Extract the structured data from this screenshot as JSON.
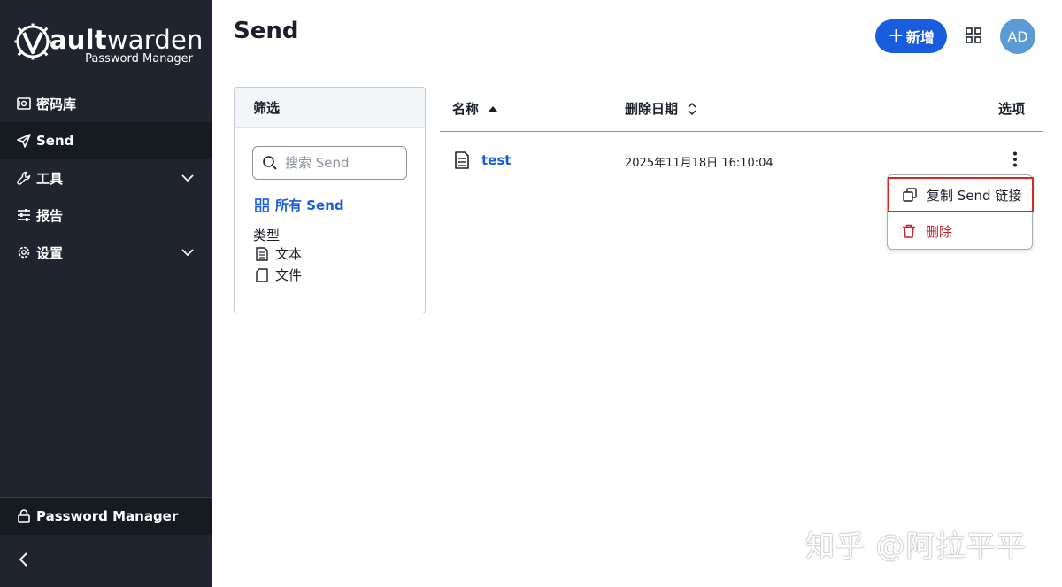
{
  "sidebar": {
    "logo": {
      "word_v": "V",
      "word_bold": "ault",
      "word_rest": "warden",
      "subtitle": "Password Manager"
    },
    "items": [
      {
        "label": "密码库",
        "icon": "vault-icon"
      },
      {
        "label": "Send",
        "icon": "send-icon",
        "active": true
      },
      {
        "label": "工具",
        "icon": "wrench-icon",
        "has_submenu": true
      },
      {
        "label": "报告",
        "icon": "sliders-icon"
      },
      {
        "label": "设置",
        "icon": "gear-icon",
        "has_submenu": true
      }
    ],
    "product_switcher": {
      "label": "Password Manager",
      "icon": "lock-icon"
    },
    "collapse_icon": "chevron-left-icon"
  },
  "header": {
    "title": "Send",
    "new_button": {
      "plus": "+",
      "label": "新增"
    },
    "avatar_initials": "AD",
    "avatar_color": "#5b9bd5"
  },
  "filter": {
    "title": "筛选",
    "search_placeholder": "搜索 Send",
    "all_sends": "所有 Send",
    "types_label": "类型",
    "types": [
      {
        "label": "文本",
        "icon": "text-file-icon"
      },
      {
        "label": "文件",
        "icon": "file-icon"
      }
    ]
  },
  "table": {
    "columns": {
      "name": "名称",
      "deletion_date": "删除日期",
      "options": "选项"
    },
    "rows": [
      {
        "name": "test",
        "deletion_date": "2025年11月18日 16:10:04",
        "icon": "text-file-icon"
      }
    ]
  },
  "menu": {
    "copy_link": "复制 Send 链接",
    "delete": "删除"
  },
  "watermark": "知乎 @阿拉平平",
  "colors": {
    "sidebar": "#1f242e",
    "primary": "#175ddc",
    "danger": "#c2262e",
    "highlight_border": "#d42a23"
  }
}
